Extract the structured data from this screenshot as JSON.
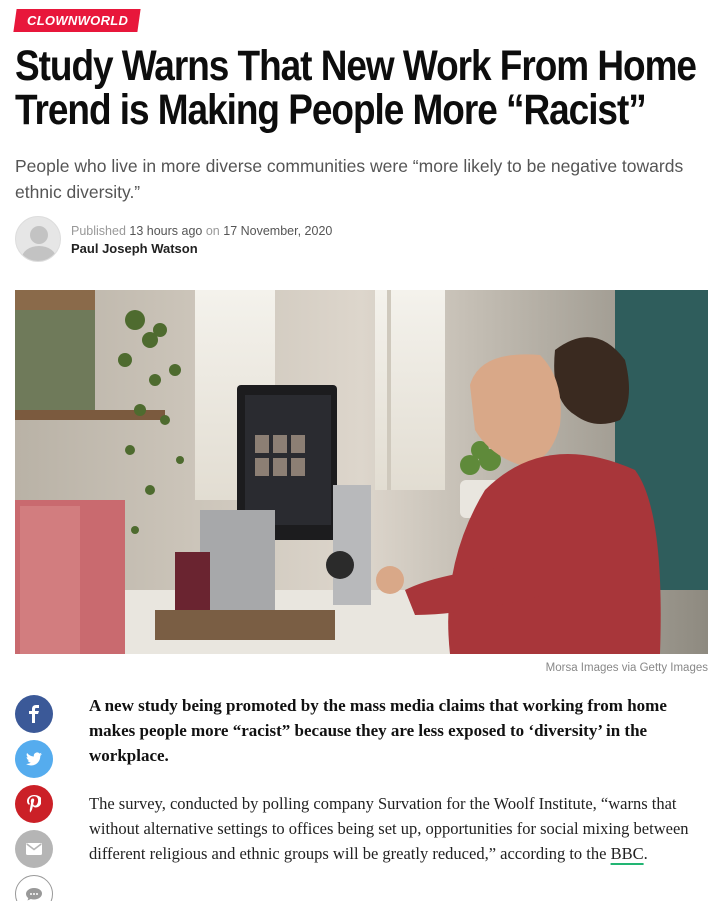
{
  "category": "CLOWNWORLD",
  "headline": {
    "line1": "Study Warns That New Work From Home",
    "line2": "Trend is Making People More “Racist”"
  },
  "subtitle": "People who live in more diverse communities were “more likely to be negative towards ethnic diversity.”",
  "byline": {
    "published_label": "Published",
    "published_ago": "13 hours ago",
    "on_label": "on",
    "date": "17 November, 2020",
    "author": "Paul Joseph Watson"
  },
  "image": {
    "caption": "Morsa Images via Getty Images"
  },
  "share": [
    {
      "icon": "facebook-icon",
      "color": "#3b5998"
    },
    {
      "icon": "twitter-icon",
      "color": "#55acee"
    },
    {
      "icon": "pinterest-icon",
      "color": "#cb2027"
    },
    {
      "icon": "email-icon",
      "color": "#b5b5b5"
    },
    {
      "icon": "comment-icon",
      "color": "#ffffff"
    }
  ],
  "article": {
    "lead": "A new study being promoted by the mass media claims that working from home makes people more “racist” because they are less exposed to ‘diversity’ in the workplace.",
    "para1_text": "The survey, conducted by polling company Survation for the Woolf Institute, “warns that without alternative settings to offices being set up, opportunities for social mixing between different religious and ethnic groups will be greatly reduced,” according to the ",
    "para1_link": "BBC",
    "para1_end": "."
  },
  "colors": {
    "accent": "#e8173b",
    "link_underline": "#22b573"
  }
}
